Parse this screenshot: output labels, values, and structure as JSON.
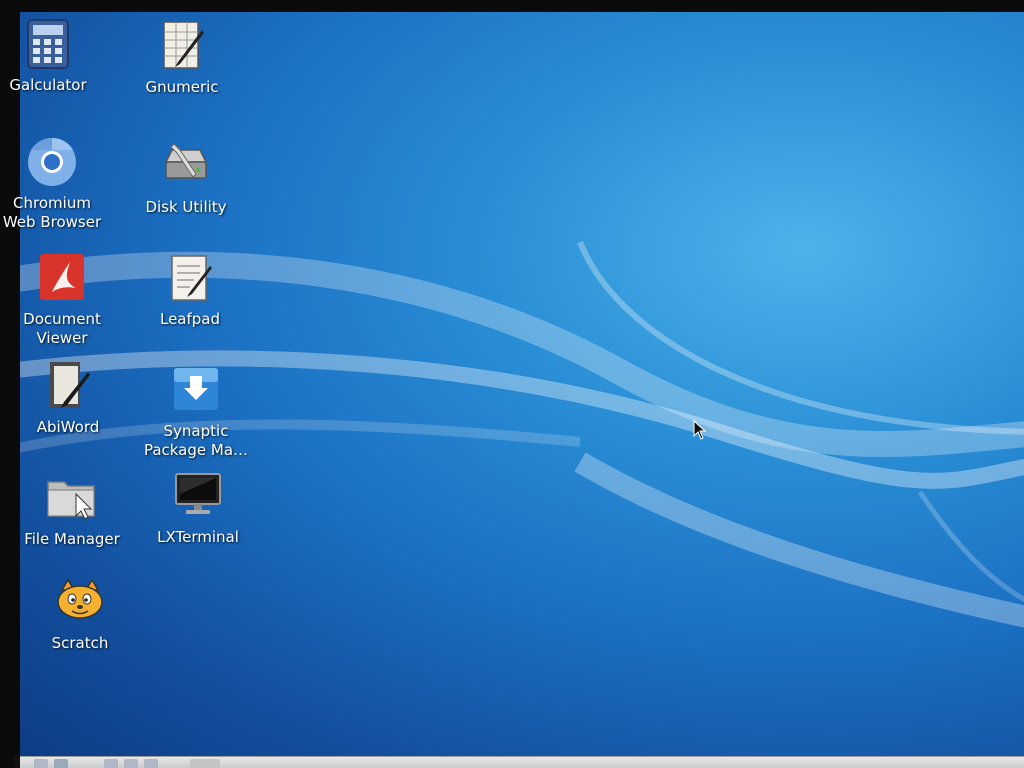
{
  "desktop": {
    "icons": [
      {
        "label": "Galculator",
        "icon": "calculator-icon"
      },
      {
        "label": "Gnumeric",
        "icon": "spreadsheet-icon"
      },
      {
        "label": "Chromium\nWeb Browser",
        "icon": "chromium-icon"
      },
      {
        "label": "Disk Utility",
        "icon": "disk-utility-icon"
      },
      {
        "label": "Document\nViewer",
        "icon": "document-viewer-icon"
      },
      {
        "label": "Leafpad",
        "icon": "text-editor-icon"
      },
      {
        "label": "AbiWord",
        "icon": "word-processor-icon"
      },
      {
        "label": "Synaptic\nPackage Ma…",
        "icon": "package-manager-icon"
      },
      {
        "label": "File Manager",
        "icon": "folder-icon"
      },
      {
        "label": "LXTerminal",
        "icon": "terminal-icon"
      },
      {
        "label": "Scratch",
        "icon": "scratch-cat-icon"
      }
    ]
  },
  "colors": {
    "wallpaper_light": "#4db3ea",
    "wallpaper_dark": "#0e3c84",
    "label_text": "#ffffff",
    "taskbar": "#d6d6d6"
  }
}
